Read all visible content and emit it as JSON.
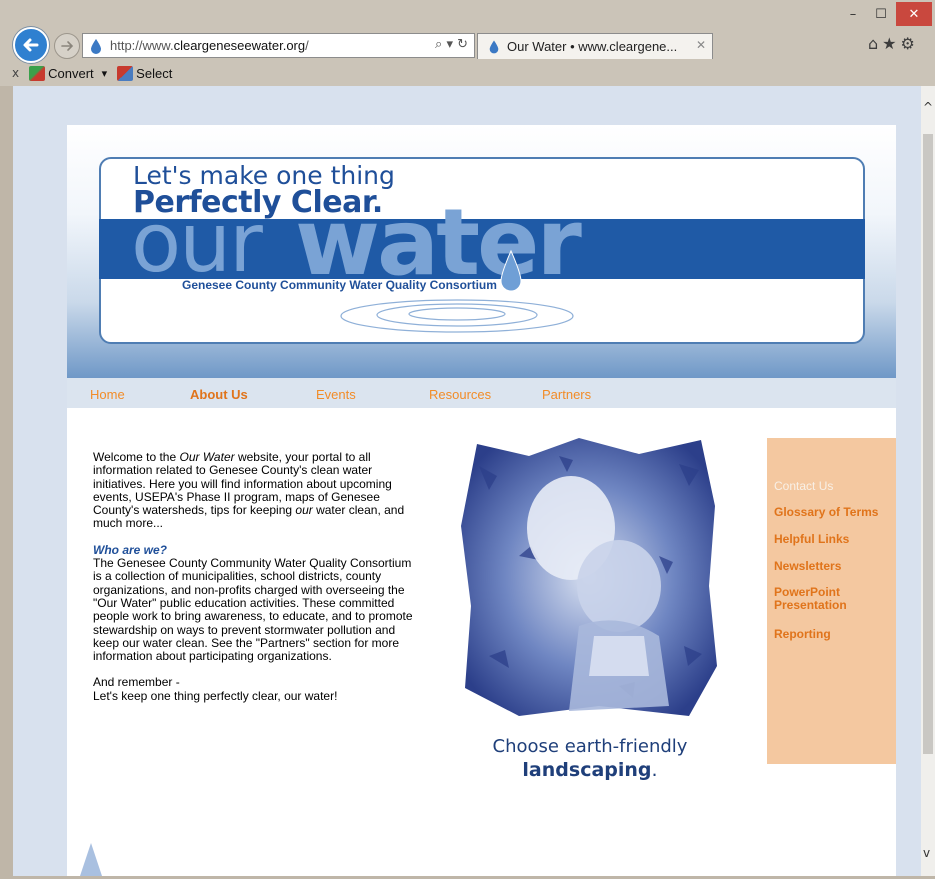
{
  "browser": {
    "url_prefix": "http://www.",
    "url_domain": "cleargeneseewater.org",
    "url_suffix": "/",
    "address_icons": "⌕ ▾ ↻",
    "tab_title": "Our Water • www.cleargene...",
    "tab_close": "✕",
    "window_controls": {
      "minimize": "–",
      "maximize": "☐",
      "close": "✕"
    },
    "right_icons": {
      "home": "⌂",
      "favorites": "★",
      "tools": "⚙"
    },
    "toolbar": {
      "close": "x",
      "convert": "Convert",
      "convert_arrow": "▾",
      "select": "Select"
    },
    "scroll": {
      "up": "^",
      "down": "v"
    }
  },
  "banner": {
    "tagline_line1": "Let's make one thing",
    "tagline_line2": "Perfectly Clear.",
    "brand_our": "our",
    "brand_water": "water",
    "consortium": "Genesee County Community Water Quality Consortium"
  },
  "nav": {
    "home": "Home",
    "about": "About Us",
    "events": "Events",
    "resources": "Resources",
    "partners": "Partners"
  },
  "content": {
    "welcome_pre": "Welcome to the ",
    "welcome_em": "Our Water",
    "welcome_mid": " website, your portal to all information related to Genesee County's clean water initiatives. Here you will find information about upcoming events, USEPA's Phase II program, maps of Genesee County's watersheds, tips for keeping ",
    "welcome_em2": "our",
    "welcome_post": " water clean, and much more...",
    "who_heading": "Who are we?",
    "who_body": "The Genesee County Community Water Quality Consortium is a collection of municipalities, school districts, county organizations, and non-profits charged with overseeing the \"Our Water\" public education activities. These committed people work to bring awareness, to educate, and to promote stewardship on ways to prevent stormwater pollution and keep our water clean.  See the \"Partners\" section for more information about participating organizations.",
    "remember_line1": "And remember -",
    "remember_line2": "Let's keep one thing perfectly clear, our water!",
    "caption_line1": "Choose earth-friendly",
    "caption_line2": "landscaping",
    "caption_period": "."
  },
  "sidebar": {
    "contact": "Contact Us",
    "glossary": "Glossary of Terms",
    "helpful": "Helpful Links",
    "newsletters": "Newsletters",
    "powerpoint": "PowerPoint Presentation",
    "reporting": "Reporting"
  },
  "colors": {
    "brand_blue": "#1f5aa6",
    "brand_light_blue": "#7aa3d5",
    "nav_orange": "#f28c28",
    "sidebar_bg": "#f4c8a0"
  }
}
